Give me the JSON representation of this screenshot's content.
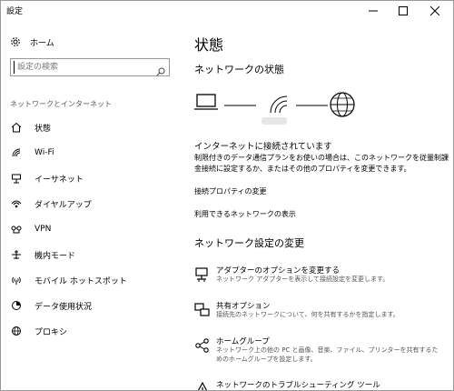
{
  "window": {
    "title": "設定",
    "minimize_icon": "minimize-icon",
    "maximize_icon": "maximize-icon",
    "close_icon": "close-icon"
  },
  "sidebar": {
    "home_label": "ホーム",
    "search_placeholder": "設定の検索",
    "section_title": "ネットワークとインターネット",
    "items": [
      {
        "label": "状態",
        "icon": "home-icon",
        "active": true
      },
      {
        "label": "Wi-Fi",
        "icon": "wifi-icon"
      },
      {
        "label": "イーサネット",
        "icon": "ethernet-icon"
      },
      {
        "label": "ダイヤルアップ",
        "icon": "dialup-icon"
      },
      {
        "label": "VPN",
        "icon": "vpn-icon"
      },
      {
        "label": "機内モード",
        "icon": "airplane-icon"
      },
      {
        "label": "モバイル ホットスポット",
        "icon": "hotspot-icon"
      },
      {
        "label": "データ使用状況",
        "icon": "data-usage-icon"
      },
      {
        "label": "プロキシ",
        "icon": "globe-icon"
      }
    ]
  },
  "main": {
    "title": "状態",
    "network_status_heading": "ネットワークの状態",
    "connected_text": "インターネットに接続されています",
    "description": "制限付きのデータ通信プランをお使いの場合は、このネットワークを従量制課金接続に設定するか、またはその他のプロパティを変更できます。",
    "link_properties": "接続プロパティの変更",
    "link_available": "利用できるネットワークの表示",
    "change_settings_heading": "ネットワーク設定の変更",
    "options": [
      {
        "title": "アダプターのオプションを変更する",
        "desc": "ネットワーク アダプターを表示して接続設定を変更します。",
        "icon": "adapter-icon"
      },
      {
        "title": "共有オプション",
        "desc": "接続先のネットワークについて、何を共有するかを指定します。",
        "icon": "sharing-icon"
      },
      {
        "title": "ホームグループ",
        "desc": "ネットワーク上の他の PC と画像、音楽、ファイル、プリンターを共有するためのホームグループを設定します。",
        "icon": "homegroup-icon"
      },
      {
        "title": "ネットワークのトラブルシューティング ツール",
        "desc": "",
        "icon": "warning-icon"
      }
    ]
  }
}
